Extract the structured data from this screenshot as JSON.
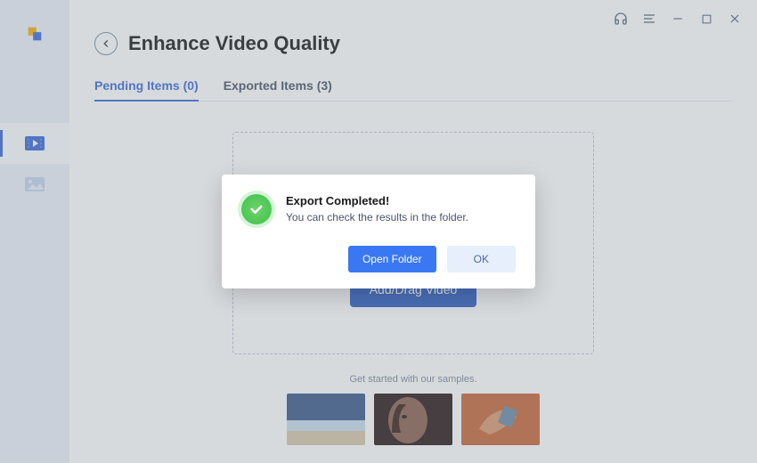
{
  "page_title": "Enhance Video Quality",
  "tabs": [
    {
      "label": "Pending Items (0)",
      "active": true
    },
    {
      "label": "Exported Items (3)",
      "active": false
    }
  ],
  "dropzone": {
    "button_label": "Add/Drag Video"
  },
  "samples_label": "Get started with our samples.",
  "dialog": {
    "title": "Export Completed!",
    "message": "You can check the results in the folder.",
    "primary_label": "Open Folder",
    "secondary_label": "OK"
  },
  "colors": {
    "accent": "#3a6ad8",
    "primary_btn": "#3a77f2",
    "sidebar_bg": "#eaf1fb"
  },
  "sidebar_items": [
    {
      "name": "home",
      "active": false
    },
    {
      "name": "video",
      "active": true
    },
    {
      "name": "image",
      "active": false
    }
  ]
}
